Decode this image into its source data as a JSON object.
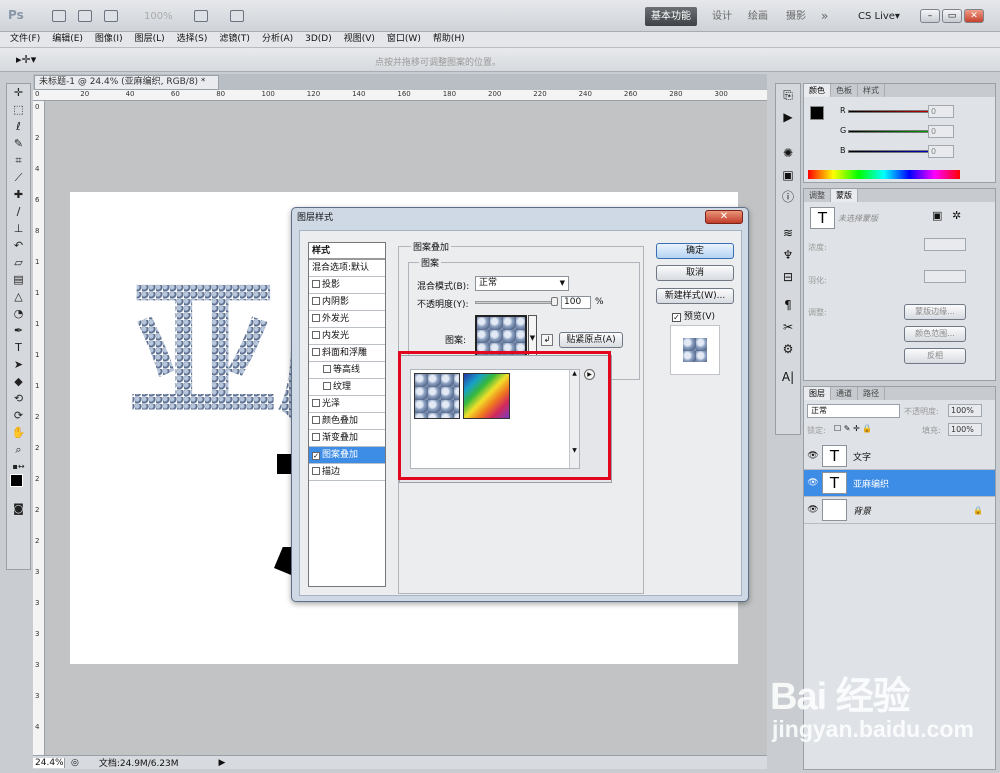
{
  "app": {
    "logo": "Ps",
    "zoom": "100%",
    "workspaces": [
      "基本功能",
      "设计",
      "绘画",
      "摄影"
    ],
    "more": "»",
    "cslive": "CS Live▾"
  },
  "menu": [
    "文件(F)",
    "编辑(E)",
    "图像(I)",
    "图层(L)",
    "选择(S)",
    "滤镜(T)",
    "分析(A)",
    "3D(D)",
    "视图(V)",
    "窗口(W)",
    "帮助(H)"
  ],
  "options": {
    "hint": "点按并拖移可调整图案的位置。"
  },
  "document": {
    "tab": "未标题-1 @ 24.4% (亚麻编织, RGB/8) *",
    "ruler_top": [
      "0",
      "20",
      "40",
      "60",
      "80",
      "100",
      "120",
      "140",
      "160",
      "180",
      "200",
      "220",
      "240",
      "260",
      "280",
      "300"
    ],
    "ruler_left": [
      "0",
      "2",
      "4",
      "6",
      "8",
      "1",
      "1",
      "1",
      "1",
      "1",
      "2",
      "2",
      "2",
      "2",
      "2",
      "3",
      "3",
      "3",
      "3",
      "3",
      "4"
    ],
    "canvas_text": "亚麻"
  },
  "status": {
    "zoom": "24.4%",
    "doc": "文档:24.9M/6.23M"
  },
  "color_panel": {
    "tabs": [
      "颜色",
      "色板",
      "样式"
    ],
    "labels": [
      "R",
      "G",
      "B"
    ],
    "values": [
      "0",
      "0",
      "0"
    ]
  },
  "adjust_panel": {
    "tabs": [
      "调整",
      "蒙版"
    ],
    "mask_label": "未选择蒙版",
    "rows": [
      "浓度:",
      "羽化:"
    ],
    "edge_label": "调整:",
    "buttons": [
      "蒙版边缘...",
      "颜色范围...",
      "反相"
    ]
  },
  "layers_panel": {
    "tabs": [
      "图层",
      "通道",
      "路径"
    ],
    "blend": "正常",
    "opacity_label": "不透明度:",
    "opacity": "100%",
    "lock_label": "锁定:",
    "fill_label": "填充:",
    "fill": "100%",
    "layers": [
      {
        "name": "文字",
        "type": "T"
      },
      {
        "name": "亚麻编织",
        "type": "T"
      },
      {
        "name": "背景",
        "type": ""
      }
    ]
  },
  "dialog": {
    "title": "图层样式",
    "styles_header": "样式",
    "blend_default": "混合选项:默认",
    "styles": [
      {
        "label": "投影",
        "checked": false
      },
      {
        "label": "内阴影",
        "checked": false
      },
      {
        "label": "外发光",
        "checked": false
      },
      {
        "label": "内发光",
        "checked": false
      },
      {
        "label": "斜面和浮雕",
        "checked": false
      },
      {
        "label": "等高线",
        "checked": false,
        "indent": true
      },
      {
        "label": "纹理",
        "checked": false,
        "indent": true
      },
      {
        "label": "光泽",
        "checked": false
      },
      {
        "label": "颜色叠加",
        "checked": false
      },
      {
        "label": "渐变叠加",
        "checked": false
      },
      {
        "label": "图案叠加",
        "checked": true,
        "selected": true
      },
      {
        "label": "描边",
        "checked": false
      }
    ],
    "section_title": "图案叠加",
    "sub_title": "图案",
    "blend_mode_label": "混合模式(B):",
    "blend_mode": "正常",
    "opacity_label": "不透明度(Y):",
    "opacity": "100",
    "opacity_unit": "%",
    "pattern_label": "图案:",
    "snap_button": "贴紧原点(A)",
    "ok": "确定",
    "cancel": "取消",
    "new_style": "新建样式(W)...",
    "preview_label": "预览(V)"
  },
  "watermark": {
    "brand": "Bai 经验",
    "url": "jingyan.baidu.com"
  }
}
